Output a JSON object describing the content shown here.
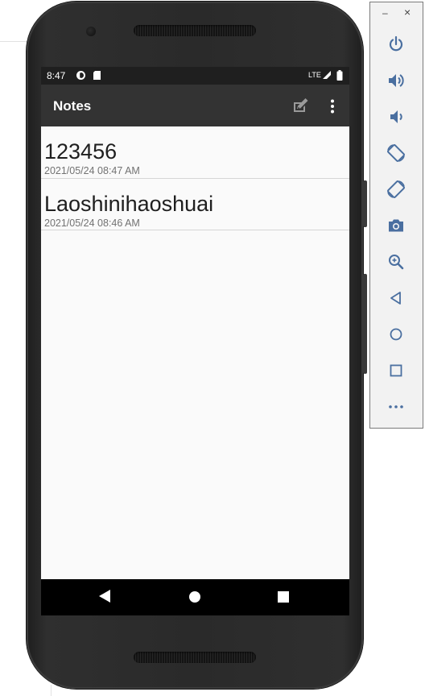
{
  "status_bar": {
    "time": "8:47",
    "network_label": "LTE"
  },
  "app_bar": {
    "title": "Notes",
    "actions": [
      "compose-icon",
      "overflow-menu-icon"
    ]
  },
  "notes": [
    {
      "title": "123456",
      "date": "2021/05/24 08:47 AM"
    },
    {
      "title": "Laoshinihaoshuai",
      "date": "2021/05/24 08:46 AM"
    }
  ],
  "nav_bar": {
    "buttons": [
      "back-icon",
      "home-icon",
      "recents-icon"
    ]
  },
  "emulator_panel": {
    "window_controls": {
      "minimize": "–",
      "close": "×"
    },
    "buttons": [
      "power",
      "volume-up",
      "volume-down",
      "rotate-left",
      "rotate-right",
      "screenshot",
      "zoom",
      "back",
      "home",
      "overview",
      "more"
    ]
  },
  "colors": {
    "app_bar": "#333333",
    "status_bar": "#1f1f1f",
    "screen_background": "#fafafa",
    "panel_icon": "#4a6fa0"
  }
}
